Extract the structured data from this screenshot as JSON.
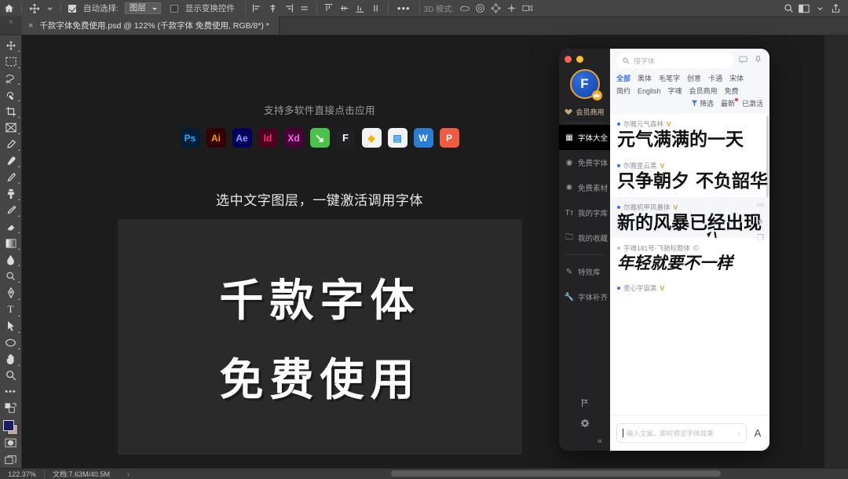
{
  "options_bar": {
    "home_icon": "home-icon",
    "move_tool_icon": "move-tool-icon",
    "auto_select_label": "自动选择:",
    "auto_select_value": "图层",
    "auto_select_checked": true,
    "show_transform_label": "显示变换控件",
    "show_transform_checked": false,
    "align_icons": [
      "align-left-icon",
      "align-center-horizontal-icon",
      "align-right-icon",
      "distribute-horizontal-icon"
    ],
    "distribute_icons": [
      "align-top-icon",
      "align-middle-icon",
      "align-bottom-icon",
      "distribute-vertical-icon"
    ],
    "more_label": "•••",
    "mode3d_label": "3D 模式:",
    "mode3d_icons": [
      "orbit-3d-icon",
      "roll-3d-icon",
      "pan-3d-icon",
      "slide-3d-icon",
      "camera-3d-icon"
    ],
    "right_icons": [
      "search-icon",
      "workspace-icon",
      "chevron-down-icon",
      "share-icon"
    ]
  },
  "tab_bar": {
    "gutter_label": "»",
    "close_label": "×",
    "title": "千款字体免费使用.psd @ 122% (千款字体 免费使用, RGB/8*) *"
  },
  "toolbar": {
    "tools": [
      {
        "name": "move-tool",
        "glyph": "✥",
        "active": false
      },
      {
        "name": "marquee-tool",
        "glyph": "▭",
        "active": false
      },
      {
        "name": "lasso-tool",
        "glyph": "𝓛",
        "active": false
      },
      {
        "name": "quick-selection-tool",
        "glyph": "✎",
        "active": false
      },
      {
        "name": "crop-tool",
        "glyph": "⌗",
        "active": false
      },
      {
        "name": "frame-tool",
        "glyph": "⊠",
        "active": false
      },
      {
        "name": "eyedropper-tool",
        "glyph": "✒",
        "active": false
      },
      {
        "name": "healing-brush-tool",
        "glyph": "⚕",
        "active": false
      },
      {
        "name": "brush-tool",
        "glyph": "🖌",
        "active": false
      },
      {
        "name": "clone-stamp-tool",
        "glyph": "⚲",
        "active": false
      },
      {
        "name": "history-brush-tool",
        "glyph": "✏",
        "active": false
      },
      {
        "name": "eraser-tool",
        "glyph": "◣",
        "active": false
      },
      {
        "name": "gradient-tool",
        "glyph": "▦",
        "active": false
      },
      {
        "name": "blur-tool",
        "glyph": "◗",
        "active": false
      },
      {
        "name": "dodge-tool",
        "glyph": "●",
        "active": false
      },
      {
        "name": "pen-tool",
        "glyph": "✑",
        "active": false
      },
      {
        "name": "type-tool",
        "glyph": "T",
        "active": false
      },
      {
        "name": "path-selection-tool",
        "glyph": "➤",
        "active": false
      },
      {
        "name": "ellipse-tool",
        "glyph": "⬭",
        "active": false
      },
      {
        "name": "hand-tool",
        "glyph": "✋",
        "active": false
      },
      {
        "name": "zoom-tool",
        "glyph": "⌕",
        "active": false
      },
      {
        "name": "edit-toolbar",
        "glyph": "•••",
        "active": false
      }
    ],
    "color_swatch_icon": "foreground-background-color-swatch",
    "quick_mask_icon": "quick-mask-icon",
    "screen_mode_icon": "screen-mode-icon"
  },
  "canvas": {
    "heading_top": "支持多软件直接点击应用",
    "heading_mid": "选中文字图层，一键激活调用字体",
    "apps": [
      {
        "name": "photoshop",
        "label": "Ps",
        "bg": "#001E36",
        "fg": "#31A8FF"
      },
      {
        "name": "illustrator",
        "label": "Ai",
        "bg": "#330000",
        "fg": "#FF9A00"
      },
      {
        "name": "after-effects",
        "label": "Ae",
        "bg": "#00005B",
        "fg": "#9999FF"
      },
      {
        "name": "indesign",
        "label": "Id",
        "bg": "#49021F",
        "fg": "#FF3366"
      },
      {
        "name": "xd",
        "label": "Xd",
        "bg": "#470137",
        "fg": "#FF61F6"
      },
      {
        "name": "keynote-green",
        "label": "↘",
        "bg": "#4CC14C",
        "fg": "#ffffff"
      },
      {
        "name": "figma",
        "label": "F",
        "bg": "#1f1f24",
        "fg": "#ffffff"
      },
      {
        "name": "sketch",
        "label": "◆",
        "bg": "#f3f3f3",
        "fg": "#F7B500"
      },
      {
        "name": "keynote",
        "label": "▤",
        "bg": "#f3f3f3",
        "fg": "#2C8FE8"
      },
      {
        "name": "word",
        "label": "W",
        "bg": "#2B7CD3",
        "fg": "#ffffff"
      },
      {
        "name": "powerpoint",
        "label": "P",
        "bg": "#F15B42",
        "fg": "#ffffff"
      }
    ],
    "big_text_line1": "千款字体",
    "big_text_line2": "免费使用"
  },
  "status_bar": {
    "zoom": "122.37%",
    "doc_info": "文档:7.63M/40.5M",
    "arrow": "›"
  },
  "font_panel": {
    "traffic_lights": [
      "#ff5f57",
      "#febc2e"
    ],
    "logo_letter": "F",
    "logo_badge_icon": "crown-badge-icon",
    "vip_label": "会员商用",
    "vip_icon": "heart-icon",
    "nav_items": [
      {
        "name": "font-library",
        "label": "字体大全",
        "icon": "grid-icon",
        "active": true
      },
      {
        "name": "free-fonts",
        "label": "免费字体",
        "icon": "circle-icon",
        "active": false
      },
      {
        "name": "free-assets",
        "label": "免费素材",
        "icon": "flower-icon",
        "active": false
      },
      {
        "name": "my-fonts",
        "label": "我的字库",
        "icon": "typography-icon",
        "active": false
      },
      {
        "name": "my-favorites",
        "label": "我的收藏",
        "icon": "folder-icon",
        "active": false
      },
      {
        "name": "effects-library",
        "label": "特效库",
        "icon": "magic-icon",
        "active": false
      },
      {
        "name": "font-completion",
        "label": "字体补齐",
        "icon": "wrench-icon",
        "active": false
      }
    ],
    "bottom_icons": [
      {
        "name": "feedback-icon",
        "glyph": "⌶"
      },
      {
        "name": "settings-gear-icon",
        "glyph": "⚙"
      }
    ],
    "collapse_label": "«",
    "search_placeholder": "搜字体",
    "search_icon": "search-icon",
    "header_icons": [
      {
        "name": "message-icon",
        "glyph": "▭"
      },
      {
        "name": "pin-icon",
        "glyph": "⚲"
      }
    ],
    "tags_row1": [
      "全部",
      "黑体",
      "毛笔字",
      "创意",
      "卡通",
      "宋体"
    ],
    "tags_row2": [
      "简约",
      "English",
      "字魂",
      "会员商用",
      "免费"
    ],
    "tags_row3": [
      "最新",
      "已激活"
    ],
    "selected_tag": "全部",
    "new_tag": "最新",
    "filter_label": "筛选",
    "filter_icon": "filter-icon",
    "fonts": [
      {
        "name": "尔雅元气森林",
        "badge": "V",
        "badge_type": "vip",
        "sample": "元气满满的一天",
        "alt": false,
        "italic": false
      },
      {
        "name": "尔雅星云黑",
        "badge": "V",
        "badge_type": "vip",
        "sample": "只争朝夕 不负韶华",
        "alt": false,
        "italic": false
      },
      {
        "name": "尔雅机甲风暴体",
        "badge": "V",
        "badge_type": "vip",
        "sample": "新的风暴已经出现",
        "alt": true,
        "italic": false
      },
      {
        "name": "字魂181号-飞驰标题体",
        "badge": "©",
        "badge_type": "copyright",
        "sample": "年轻就要不一样",
        "alt": false,
        "italic": true
      },
      {
        "name": "壹心宇宙黑",
        "badge": "V",
        "badge_type": "vip",
        "sample": "",
        "alt": false,
        "italic": false
      }
    ],
    "card_action_icons": [
      {
        "name": "comment-icon",
        "glyph": "▭"
      },
      {
        "name": "favorite-star-icon",
        "glyph": "★"
      },
      {
        "name": "copy-icon",
        "glyph": "❐"
      }
    ],
    "preview_placeholder": "输入文案，即时预览字体效果",
    "preview_chevron": "›",
    "preview_size_label": "A"
  }
}
